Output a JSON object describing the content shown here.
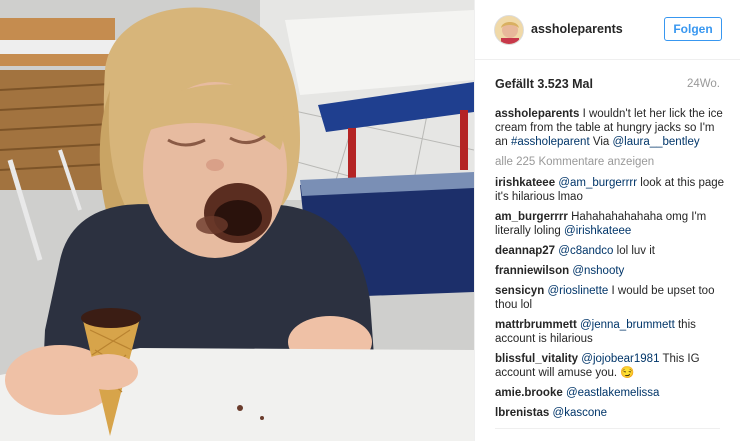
{
  "post": {
    "account": "assholeparents",
    "follow_label": "Folgen",
    "likes_label": "Gefällt 3.523 Mal",
    "age": "24Wo.",
    "caption": {
      "user": "assholeparents",
      "text_1": " I wouldn't let her lick the ice cream from the table at hungry jacks so I'm an ",
      "hashtag": "#assholeparent",
      "text_2": " Via ",
      "mention": "@laura__bentley"
    },
    "more_comments": "alle 225 Kommentare anzeigen",
    "comments": [
      {
        "user": "irishkateee",
        "mention": "@am_burgerrrr",
        "text": " look at this page it's hilarious lmao"
      },
      {
        "user": "am_burgerrrr",
        "mention": "",
        "text": " Hahahahahahaha omg I'm literally loling ",
        "mention_after": "@irishkateee"
      },
      {
        "user": "deannap27",
        "mention": "@c8andco",
        "text": " lol luv it"
      },
      {
        "user": "franniewilson",
        "mention": "@nshooty",
        "text": ""
      },
      {
        "user": "sensicyn",
        "mention": "@rioslinette",
        "text": " I would be upset too thou lol"
      },
      {
        "user": "mattrbrummett",
        "mention": "@jenna_brummett",
        "text": " this account is hilarious"
      },
      {
        "user": "blissful_vitality",
        "mention": "@jojobear1981",
        "text": " This IG account will amuse you. 😏"
      },
      {
        "user": "amie.brooke",
        "mention": "@eastlakemelissa",
        "text": ""
      },
      {
        "user": "lbrenistas",
        "mention": "@kascone",
        "text": ""
      }
    ],
    "colors": {
      "link": "#003569",
      "follow": "#3897f0",
      "muted": "#999999"
    }
  }
}
